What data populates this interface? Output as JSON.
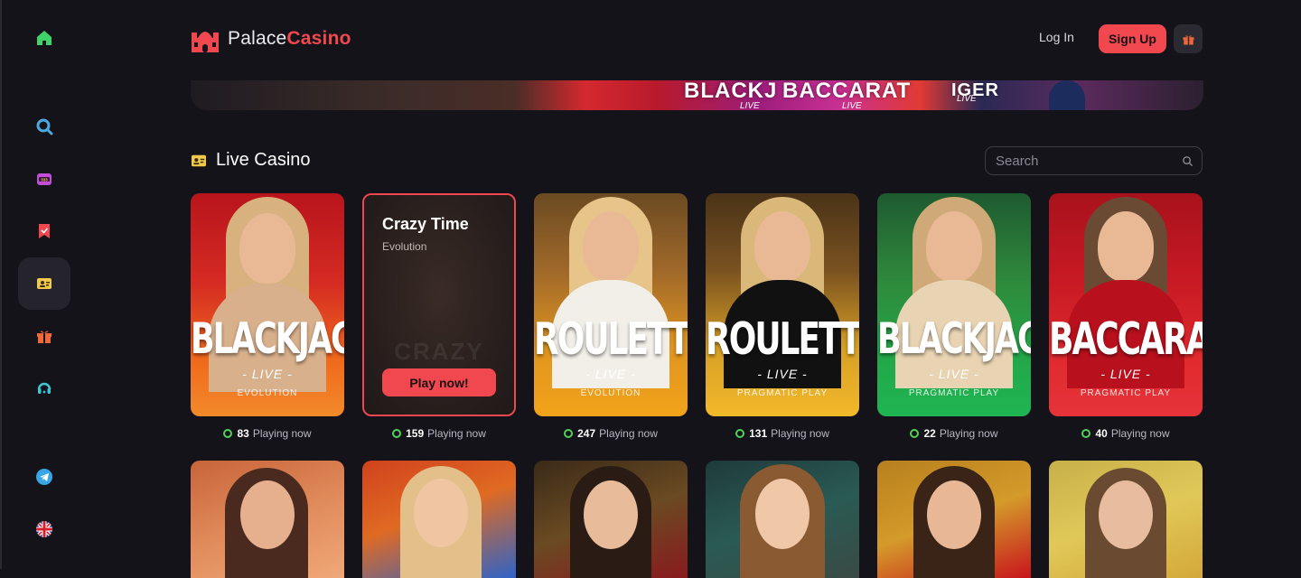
{
  "header": {
    "logo_part1": "Palace",
    "logo_part2": "Casino",
    "login_label": "Log In",
    "signup_label": "Sign Up"
  },
  "sidebar": {
    "items": [
      {
        "icon": "home-icon",
        "color": "#3fd46a"
      },
      {
        "icon": "search-icon",
        "color": "#4aa9e0"
      },
      {
        "icon": "slots-icon",
        "color": "#c04fd6"
      },
      {
        "icon": "bookmark-icon",
        "color": "#f0484e"
      },
      {
        "icon": "live-casino-icon",
        "color": "#f2c94c",
        "active": true
      },
      {
        "icon": "gift-icon",
        "color": "#f0673a"
      },
      {
        "icon": "support-icon",
        "color": "#3fc6d4"
      },
      {
        "icon": "telegram-icon",
        "color": "#38a6e6"
      },
      {
        "icon": "uk-flag-icon",
        "color": "#ffffff"
      }
    ]
  },
  "banner": {
    "texts": [
      "BLACKJ",
      "BACCARAT",
      "IGER"
    ],
    "subtexts": [
      "LIVE",
      "LIVE",
      "LIVE"
    ]
  },
  "section": {
    "title": "Live Casino",
    "search_placeholder": "Search"
  },
  "games": [
    {
      "title": "BLACKJACK",
      "live": "- LIVE -",
      "provider": "EVOLUTION",
      "playing": "83",
      "theme": "orange"
    },
    {
      "title": "Crazy Time",
      "provider": "Evolution",
      "overlay_title": "CRAZY",
      "playing": "159",
      "hover": true,
      "play_label": "Play now!"
    },
    {
      "title": "ROULETTE",
      "live": "- LIVE -",
      "provider": "EVOLUTION",
      "playing": "247",
      "theme": "amber"
    },
    {
      "title": "ROULETTE",
      "live": "- LIVE -",
      "provider": "PRAGMATIC PLAY",
      "playing": "131",
      "theme": "gold"
    },
    {
      "title": "BLACKJACK",
      "live": "- LIVE -",
      "provider": "PRAGMATIC PLAY",
      "playing": "22",
      "theme": "green"
    },
    {
      "title": "BACCARAT",
      "live": "- LIVE -",
      "provider": "PRAGMATIC PLAY",
      "playing": "40",
      "theme": "red"
    }
  ],
  "playing_suffix": "Playing now",
  "colors": {
    "accent": "#f0484e",
    "online_dot": "#4fd15a",
    "background": "#14131a"
  }
}
